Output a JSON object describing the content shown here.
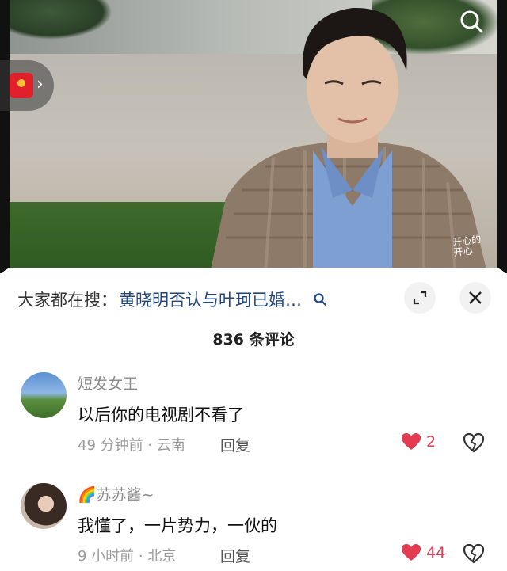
{
  "search": {
    "prefix": "大家都在搜：",
    "query": "黄晓明否认与叶珂已婚…"
  },
  "comments_header": {
    "count_label": "836 条评论"
  },
  "comments": [
    {
      "username": "短发女王",
      "text": "以后你的电视剧不看了",
      "time_location": "49 分钟前 · 云南",
      "reply_label": "回复",
      "likes": "2"
    },
    {
      "username": "🌈苏苏酱~",
      "text": "我懂了，一片势力，一伙的",
      "time_location": "9 小时前 · 北京",
      "reply_label": "回复",
      "likes": "44"
    }
  ],
  "video": {
    "watermark_line1": "开心的",
    "watermark_line2": "开心"
  },
  "colors": {
    "accent_like": "#e23b52",
    "search_query": "#20457f",
    "red_packet": "#e2202b"
  },
  "icons": [
    "red-packet-icon",
    "chevron-right-icon",
    "search-icon",
    "expand-icon",
    "close-icon",
    "heart-icon",
    "broken-heart-icon"
  ]
}
